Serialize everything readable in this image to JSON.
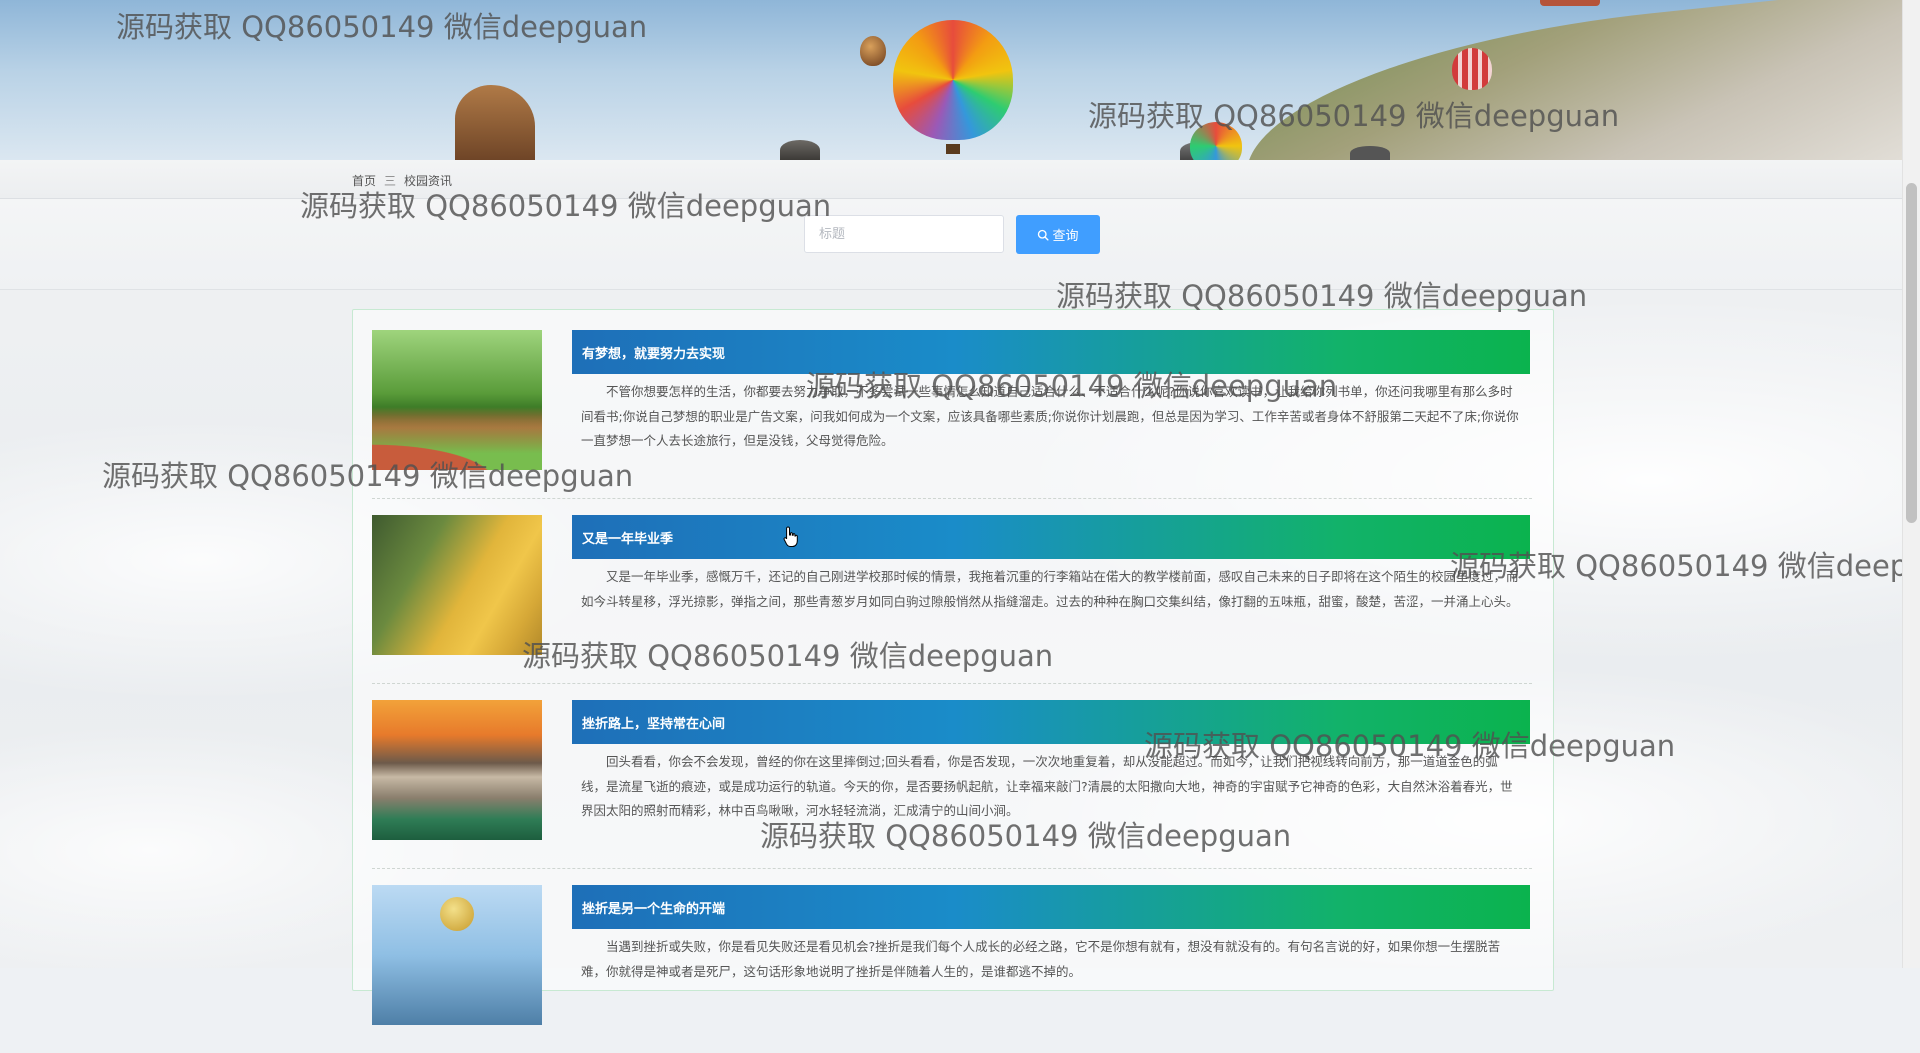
{
  "breadcrumb": {
    "home": "首页",
    "separator": "三",
    "current": "校园资讯"
  },
  "search": {
    "placeholder": "标题",
    "value": "",
    "button_label": "查询"
  },
  "news": [
    {
      "title": "有梦想，就要努力去实现",
      "excerpt": "不管你想要怎样的生活，你都要去努力争取，不多尝试一些事情怎么知道自己适合什么、不适合什么呢?你说你喜欢读书，让我给你列书单，你还问我哪里有那么多时间看书;你说自己梦想的职业是广告文案，问我如何成为一个文案，应该具备哪些素质;你说你计划晨跑，但总是因为学习、工作辛苦或者身体不舒服第二天起不了床;你说你一直梦想一个人去长途旅行，但是没钱，父母觉得危险。"
    },
    {
      "title": "又是一年毕业季",
      "excerpt": "又是一年毕业季，感慨万千，还记的自己刚进学校那时候的情景，我拖着沉重的行李箱站在偌大的教学楼前面，感叹自己未来的日子即将在这个陌生的校园里度过，而如今斗转星移，浮光掠影，弹指之间，那些青葱岁月如同白驹过隙般悄然从指缝溜走。过去的种种在胸口交集纠结，像打翻的五味瓶，甜蜜，酸楚，苦涩，一并涌上心头。"
    },
    {
      "title": "挫折路上，坚持常在心间",
      "excerpt": "回头看看，你会不会发现，曾经的你在这里摔倒过;回头看看，你是否发现，一次次地重复着，却从没能超过。而如今，让我们把视线转向前方，那一道道金色的弧线，是流星飞逝的痕迹，或是成功运行的轨道。今天的你，是否要扬帆起航，让幸福来敲门?清晨的太阳撒向大地，神奇的宇宙赋予它神奇的色彩，大自然沐浴着春光，世界因太阳的照射而精彩，林中百鸟啾啾，河水轻轻流淌，汇成清宁的山间小涧。"
    },
    {
      "title": "挫折是另一个生命的开端",
      "excerpt": "当遇到挫折或失败，你是看见失败还是看见机会?挫折是我们每个人成长的必经之路，它不是你想有就有，想没有就没有的。有句名言说的好，如果你想一生摆脱苦难，你就得是神或者是死尸，这句话形象地说明了挫折是伴随着人生的，是谁都逃不掉的。"
    }
  ],
  "watermark": "源码获取 QQ86050149 微信deepguan"
}
